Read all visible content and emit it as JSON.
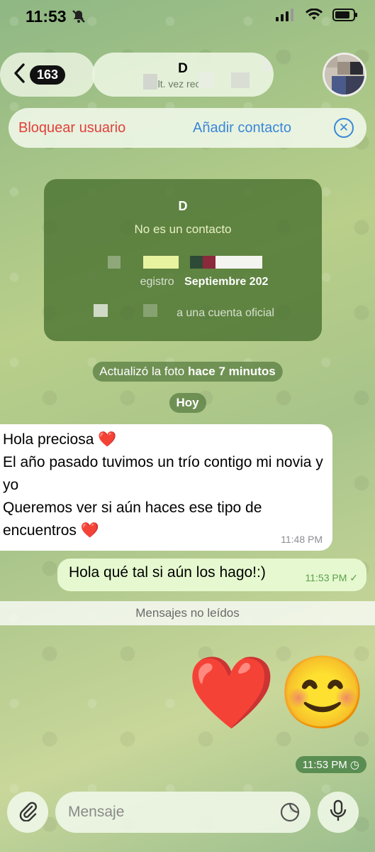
{
  "status_bar": {
    "time": "11:53"
  },
  "header": {
    "back_count": "163",
    "name": "D",
    "subtitle": "últ. vez recién"
  },
  "actions": {
    "block_label": "Bloquear usuario",
    "add_label": "Añadir contacto"
  },
  "info_card": {
    "name": "D",
    "status": "No es un contacto",
    "registration_text": "egistro",
    "registration_month": "Septiembre 202",
    "official_text": "a una cuenta oficial"
  },
  "system": {
    "photo_update_prefix": "Actualizó la foto",
    "photo_update_time": "hace 7 minutos",
    "date_label": "Hoy"
  },
  "messages": [
    {
      "direction": "in",
      "lines": [
        "Hola preciosa ❤️",
        "El año pasado tuvimos un trío contigo mi novia y yo",
        "Queremos ver si aún haces ese tipo de encuentros ❤️"
      ],
      "time": "11:48 PM"
    },
    {
      "direction": "out",
      "text": "Hola qué tal si aún los hago!:)",
      "time": "11:53 PM"
    },
    {
      "direction": "out",
      "text": "❤️😊",
      "time": "11:53 PM"
    }
  ],
  "unread_label": "Mensajes no leídos",
  "input": {
    "placeholder": "Mensaje"
  },
  "colors": {
    "block": "#e0413a",
    "add": "#3a86d8",
    "outgoing_bubble": "#e6f8cf"
  }
}
